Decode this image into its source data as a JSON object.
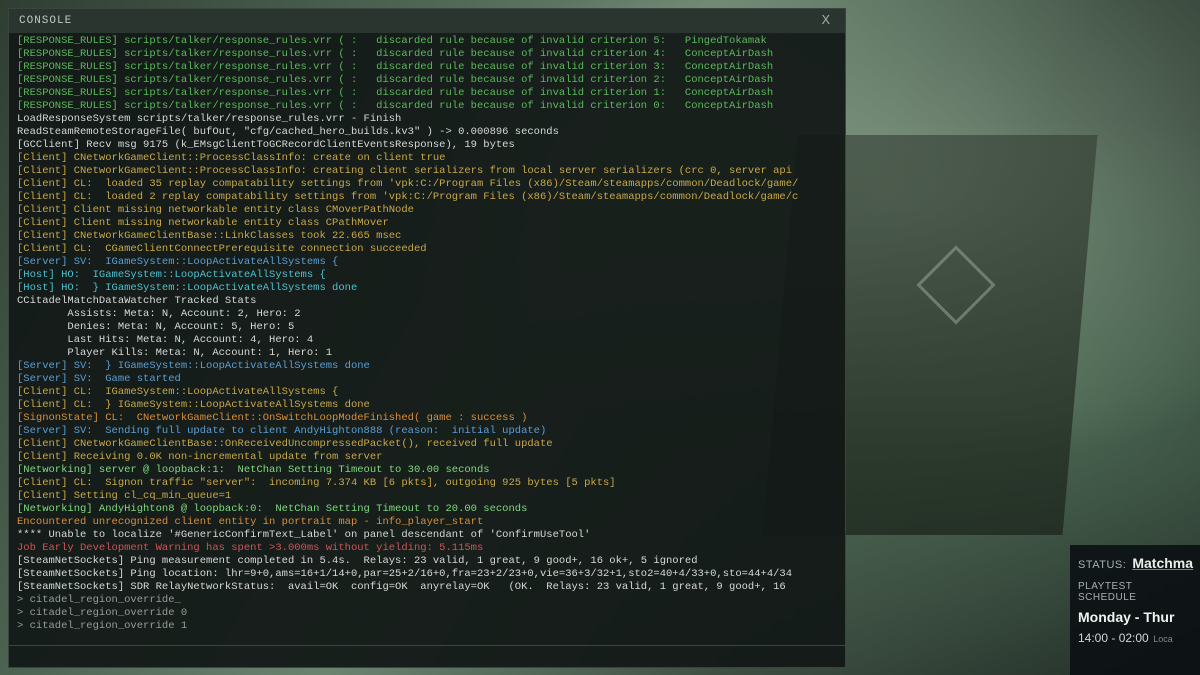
{
  "console": {
    "title": "CONSOLE",
    "close": "X",
    "lines": [
      {
        "cls": "c-green",
        "text": "[RESPONSE_RULES] scripts/talker/response_rules.vrr ( :   discarded rule because of invalid criterion 5:   PingedTokamak"
      },
      {
        "cls": "c-green",
        "text": "[RESPONSE_RULES] scripts/talker/response_rules.vrr ( :   discarded rule because of invalid criterion 4:   ConceptAirDash"
      },
      {
        "cls": "c-green",
        "text": "[RESPONSE_RULES] scripts/talker/response_rules.vrr ( :   discarded rule because of invalid criterion 3:   ConceptAirDash"
      },
      {
        "cls": "c-green",
        "text": "[RESPONSE_RULES] scripts/talker/response_rules.vrr ( :   discarded rule because of invalid criterion 2:   ConceptAirDash"
      },
      {
        "cls": "c-green",
        "text": "[RESPONSE_RULES] scripts/talker/response_rules.vrr ( :   discarded rule because of invalid criterion 1:   ConceptAirDash"
      },
      {
        "cls": "c-green",
        "text": "[RESPONSE_RULES] scripts/talker/response_rules.vrr ( :   discarded rule because of invalid criterion 0:   ConceptAirDash"
      },
      {
        "cls": "c-white",
        "text": "LoadResponseSystem scripts/talker/response_rules.vrr - Finish"
      },
      {
        "cls": "c-white",
        "text": "ReadSteamRemoteStorageFile( bufOut, \"cfg/cached_hero_builds.kv3\" ) -> 0.000896 seconds"
      },
      {
        "cls": "c-white",
        "text": "[GCClient] Recv msg 9175 (k_EMsgClientToGCRecordClientEventsResponse), 19 bytes"
      },
      {
        "cls": "c-yellow",
        "text": "[Client] CNetworkGameClient::ProcessClassInfo: create on client true"
      },
      {
        "cls": "c-yellow",
        "text": "[Client] CNetworkGameClient::ProcessClassInfo: creating client serializers from local server serializers (crc 0, server api"
      },
      {
        "cls": "c-yellow",
        "text": "[Client] CL:  loaded 35 replay compatability settings from 'vpk:C:/Program Files (x86)/Steam/steamapps/common/Deadlock/game/"
      },
      {
        "cls": "c-yellow",
        "text": "[Client] CL:  loaded 2 replay compatability settings from 'vpk:C:/Program Files (x86)/Steam/steamapps/common/Deadlock/game/c"
      },
      {
        "cls": "c-yellow",
        "text": "[Client] Client missing networkable entity class CMoverPathNode"
      },
      {
        "cls": "c-yellow",
        "text": "[Client] Client missing networkable entity class CPathMover"
      },
      {
        "cls": "c-yellow",
        "text": "[Client] CNetworkGameClientBase::LinkClasses took 22.665 msec"
      },
      {
        "cls": "c-yellow",
        "text": "[Client] CL:  CGameClientConnectPrerequisite connection succeeded"
      },
      {
        "cls": "c-blue",
        "text": "[Server] SV:  IGameSystem::LoopActivateAllSystems {"
      },
      {
        "cls": "c-cyan",
        "text": "[Host] HO:  IGameSystem::LoopActivateAllSystems {"
      },
      {
        "cls": "c-cyan",
        "text": "[Host] HO:  } IGameSystem::LoopActivateAllSystems done"
      },
      {
        "cls": "c-white",
        "text": "CCitadelMatchDataWatcher Tracked Stats"
      },
      {
        "cls": "c-white",
        "text": "        Assists: Meta: N, Account: 2, Hero: 2"
      },
      {
        "cls": "c-white",
        "text": "        Denies: Meta: N, Account: 5, Hero: 5"
      },
      {
        "cls": "c-white",
        "text": "        Last Hits: Meta: N, Account: 4, Hero: 4"
      },
      {
        "cls": "c-white",
        "text": "        Player Kills: Meta: N, Account: 1, Hero: 1"
      },
      {
        "cls": "c-blue",
        "text": "[Server] SV:  } IGameSystem::LoopActivateAllSystems done"
      },
      {
        "cls": "c-blue",
        "text": "[Server] SV:  Game started"
      },
      {
        "cls": "c-yellow",
        "text": "[Client] CL:  IGameSystem::LoopActivateAllSystems {"
      },
      {
        "cls": "c-yellow",
        "text": "[Client] CL:  } IGameSystem::LoopActivateAllSystems done"
      },
      {
        "cls": "c-orange",
        "text": "[SignonState] CL:  CNetworkGameClient::OnSwitchLoopModeFinished( game : success )"
      },
      {
        "cls": "c-blue",
        "text": "[Server] SV:  Sending full update to client AndyHighton888 (reason:  initial update)"
      },
      {
        "cls": "c-yellow",
        "text": "[Client] CNetworkGameClientBase::OnReceivedUncompressedPacket(), received full update"
      },
      {
        "cls": "c-yellow",
        "text": "[Client] Receiving 0.0K non-incremental update from server"
      },
      {
        "cls": "c-bgreen",
        "text": "[Networking] server @ loopback:1:  NetChan Setting Timeout to 30.00 seconds"
      },
      {
        "cls": "c-yellow",
        "text": "[Client] CL:  Signon traffic \"server\":  incoming 7.374 KB [6 pkts], outgoing 925 bytes [5 pkts]"
      },
      {
        "cls": "c-yellow",
        "text": "[Client] Setting cl_cq_min_queue=1"
      },
      {
        "cls": "c-bgreen",
        "text": "[Networking] AndyHighton8 @ loopback:0:  NetChan Setting Timeout to 20.00 seconds"
      },
      {
        "cls": "c-orange",
        "text": "Encountered unrecognized client entity in portrait map - info_player_start"
      },
      {
        "cls": "c-white",
        "text": "**** Unable to localize '#GenericConfirmText_Label' on panel descendant of 'ConfirmUseTool'"
      },
      {
        "cls": "c-red",
        "text": "Job Early Development Warning has spent >3.000ms without yielding: 5.115ms"
      },
      {
        "cls": "c-white",
        "text": "[SteamNetSockets] Ping measurement completed in 5.4s.  Relays: 23 valid, 1 great, 9 good+, 16 ok+, 5 ignored"
      },
      {
        "cls": "c-white",
        "text": "[SteamNetSockets] Ping location: lhr=9+0,ams=16+1/14+0,par=25+2/16+0,fra=23+2/23+0,vie=36+3/32+1,sto2=40+4/33+0,sto=44+4/34"
      },
      {
        "cls": "c-white",
        "text": "[SteamNetSockets] SDR RelayNetworkStatus:  avail=OK  config=OK  anyrelay=OK   (OK.  Relays: 23 valid, 1 great, 9 good+, 16"
      },
      {
        "cls": "c-gray",
        "text": "> citadel_region_override_"
      },
      {
        "cls": "c-gray",
        "text": "> citadel_region_override 0"
      },
      {
        "cls": "c-gray",
        "text": "> citadel_region_override 1"
      }
    ]
  },
  "status": {
    "label": "STATUS:",
    "value": "Matchma",
    "schedule_label": "PLAYTEST SCHEDULE",
    "schedule_day": "Monday - Thur",
    "schedule_time": "14:00 - 02:00",
    "schedule_tz": "Loca"
  }
}
